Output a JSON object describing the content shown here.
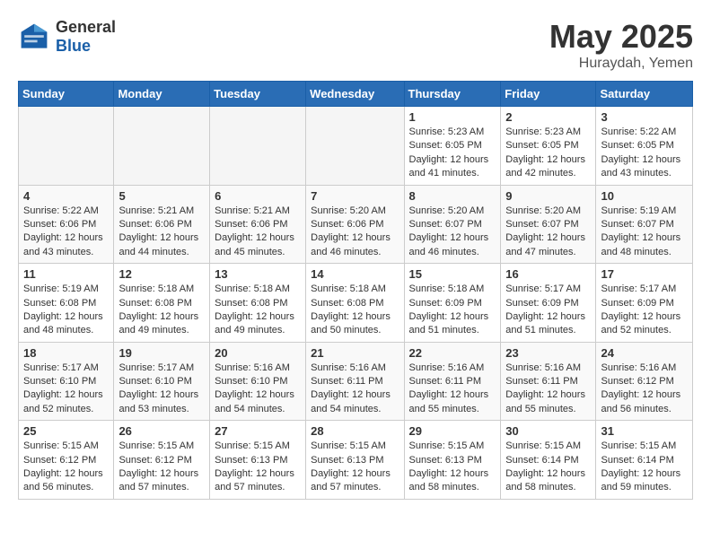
{
  "logo": {
    "general": "General",
    "blue": "Blue"
  },
  "header": {
    "month": "May 2025",
    "location": "Huraydah, Yemen"
  },
  "weekdays": [
    "Sunday",
    "Monday",
    "Tuesday",
    "Wednesday",
    "Thursday",
    "Friday",
    "Saturday"
  ],
  "weeks": [
    [
      {
        "day": "",
        "info": ""
      },
      {
        "day": "",
        "info": ""
      },
      {
        "day": "",
        "info": ""
      },
      {
        "day": "",
        "info": ""
      },
      {
        "day": "1",
        "info": "Sunrise: 5:23 AM\nSunset: 6:05 PM\nDaylight: 12 hours\nand 41 minutes."
      },
      {
        "day": "2",
        "info": "Sunrise: 5:23 AM\nSunset: 6:05 PM\nDaylight: 12 hours\nand 42 minutes."
      },
      {
        "day": "3",
        "info": "Sunrise: 5:22 AM\nSunset: 6:05 PM\nDaylight: 12 hours\nand 43 minutes."
      }
    ],
    [
      {
        "day": "4",
        "info": "Sunrise: 5:22 AM\nSunset: 6:06 PM\nDaylight: 12 hours\nand 43 minutes."
      },
      {
        "day": "5",
        "info": "Sunrise: 5:21 AM\nSunset: 6:06 PM\nDaylight: 12 hours\nand 44 minutes."
      },
      {
        "day": "6",
        "info": "Sunrise: 5:21 AM\nSunset: 6:06 PM\nDaylight: 12 hours\nand 45 minutes."
      },
      {
        "day": "7",
        "info": "Sunrise: 5:20 AM\nSunset: 6:06 PM\nDaylight: 12 hours\nand 46 minutes."
      },
      {
        "day": "8",
        "info": "Sunrise: 5:20 AM\nSunset: 6:07 PM\nDaylight: 12 hours\nand 46 minutes."
      },
      {
        "day": "9",
        "info": "Sunrise: 5:20 AM\nSunset: 6:07 PM\nDaylight: 12 hours\nand 47 minutes."
      },
      {
        "day": "10",
        "info": "Sunrise: 5:19 AM\nSunset: 6:07 PM\nDaylight: 12 hours\nand 48 minutes."
      }
    ],
    [
      {
        "day": "11",
        "info": "Sunrise: 5:19 AM\nSunset: 6:08 PM\nDaylight: 12 hours\nand 48 minutes."
      },
      {
        "day": "12",
        "info": "Sunrise: 5:18 AM\nSunset: 6:08 PM\nDaylight: 12 hours\nand 49 minutes."
      },
      {
        "day": "13",
        "info": "Sunrise: 5:18 AM\nSunset: 6:08 PM\nDaylight: 12 hours\nand 49 minutes."
      },
      {
        "day": "14",
        "info": "Sunrise: 5:18 AM\nSunset: 6:08 PM\nDaylight: 12 hours\nand 50 minutes."
      },
      {
        "day": "15",
        "info": "Sunrise: 5:18 AM\nSunset: 6:09 PM\nDaylight: 12 hours\nand 51 minutes."
      },
      {
        "day": "16",
        "info": "Sunrise: 5:17 AM\nSunset: 6:09 PM\nDaylight: 12 hours\nand 51 minutes."
      },
      {
        "day": "17",
        "info": "Sunrise: 5:17 AM\nSunset: 6:09 PM\nDaylight: 12 hours\nand 52 minutes."
      }
    ],
    [
      {
        "day": "18",
        "info": "Sunrise: 5:17 AM\nSunset: 6:10 PM\nDaylight: 12 hours\nand 52 minutes."
      },
      {
        "day": "19",
        "info": "Sunrise: 5:17 AM\nSunset: 6:10 PM\nDaylight: 12 hours\nand 53 minutes."
      },
      {
        "day": "20",
        "info": "Sunrise: 5:16 AM\nSunset: 6:10 PM\nDaylight: 12 hours\nand 54 minutes."
      },
      {
        "day": "21",
        "info": "Sunrise: 5:16 AM\nSunset: 6:11 PM\nDaylight: 12 hours\nand 54 minutes."
      },
      {
        "day": "22",
        "info": "Sunrise: 5:16 AM\nSunset: 6:11 PM\nDaylight: 12 hours\nand 55 minutes."
      },
      {
        "day": "23",
        "info": "Sunrise: 5:16 AM\nSunset: 6:11 PM\nDaylight: 12 hours\nand 55 minutes."
      },
      {
        "day": "24",
        "info": "Sunrise: 5:16 AM\nSunset: 6:12 PM\nDaylight: 12 hours\nand 56 minutes."
      }
    ],
    [
      {
        "day": "25",
        "info": "Sunrise: 5:15 AM\nSunset: 6:12 PM\nDaylight: 12 hours\nand 56 minutes."
      },
      {
        "day": "26",
        "info": "Sunrise: 5:15 AM\nSunset: 6:12 PM\nDaylight: 12 hours\nand 57 minutes."
      },
      {
        "day": "27",
        "info": "Sunrise: 5:15 AM\nSunset: 6:13 PM\nDaylight: 12 hours\nand 57 minutes."
      },
      {
        "day": "28",
        "info": "Sunrise: 5:15 AM\nSunset: 6:13 PM\nDaylight: 12 hours\nand 57 minutes."
      },
      {
        "day": "29",
        "info": "Sunrise: 5:15 AM\nSunset: 6:13 PM\nDaylight: 12 hours\nand 58 minutes."
      },
      {
        "day": "30",
        "info": "Sunrise: 5:15 AM\nSunset: 6:14 PM\nDaylight: 12 hours\nand 58 minutes."
      },
      {
        "day": "31",
        "info": "Sunrise: 5:15 AM\nSunset: 6:14 PM\nDaylight: 12 hours\nand 59 minutes."
      }
    ]
  ]
}
